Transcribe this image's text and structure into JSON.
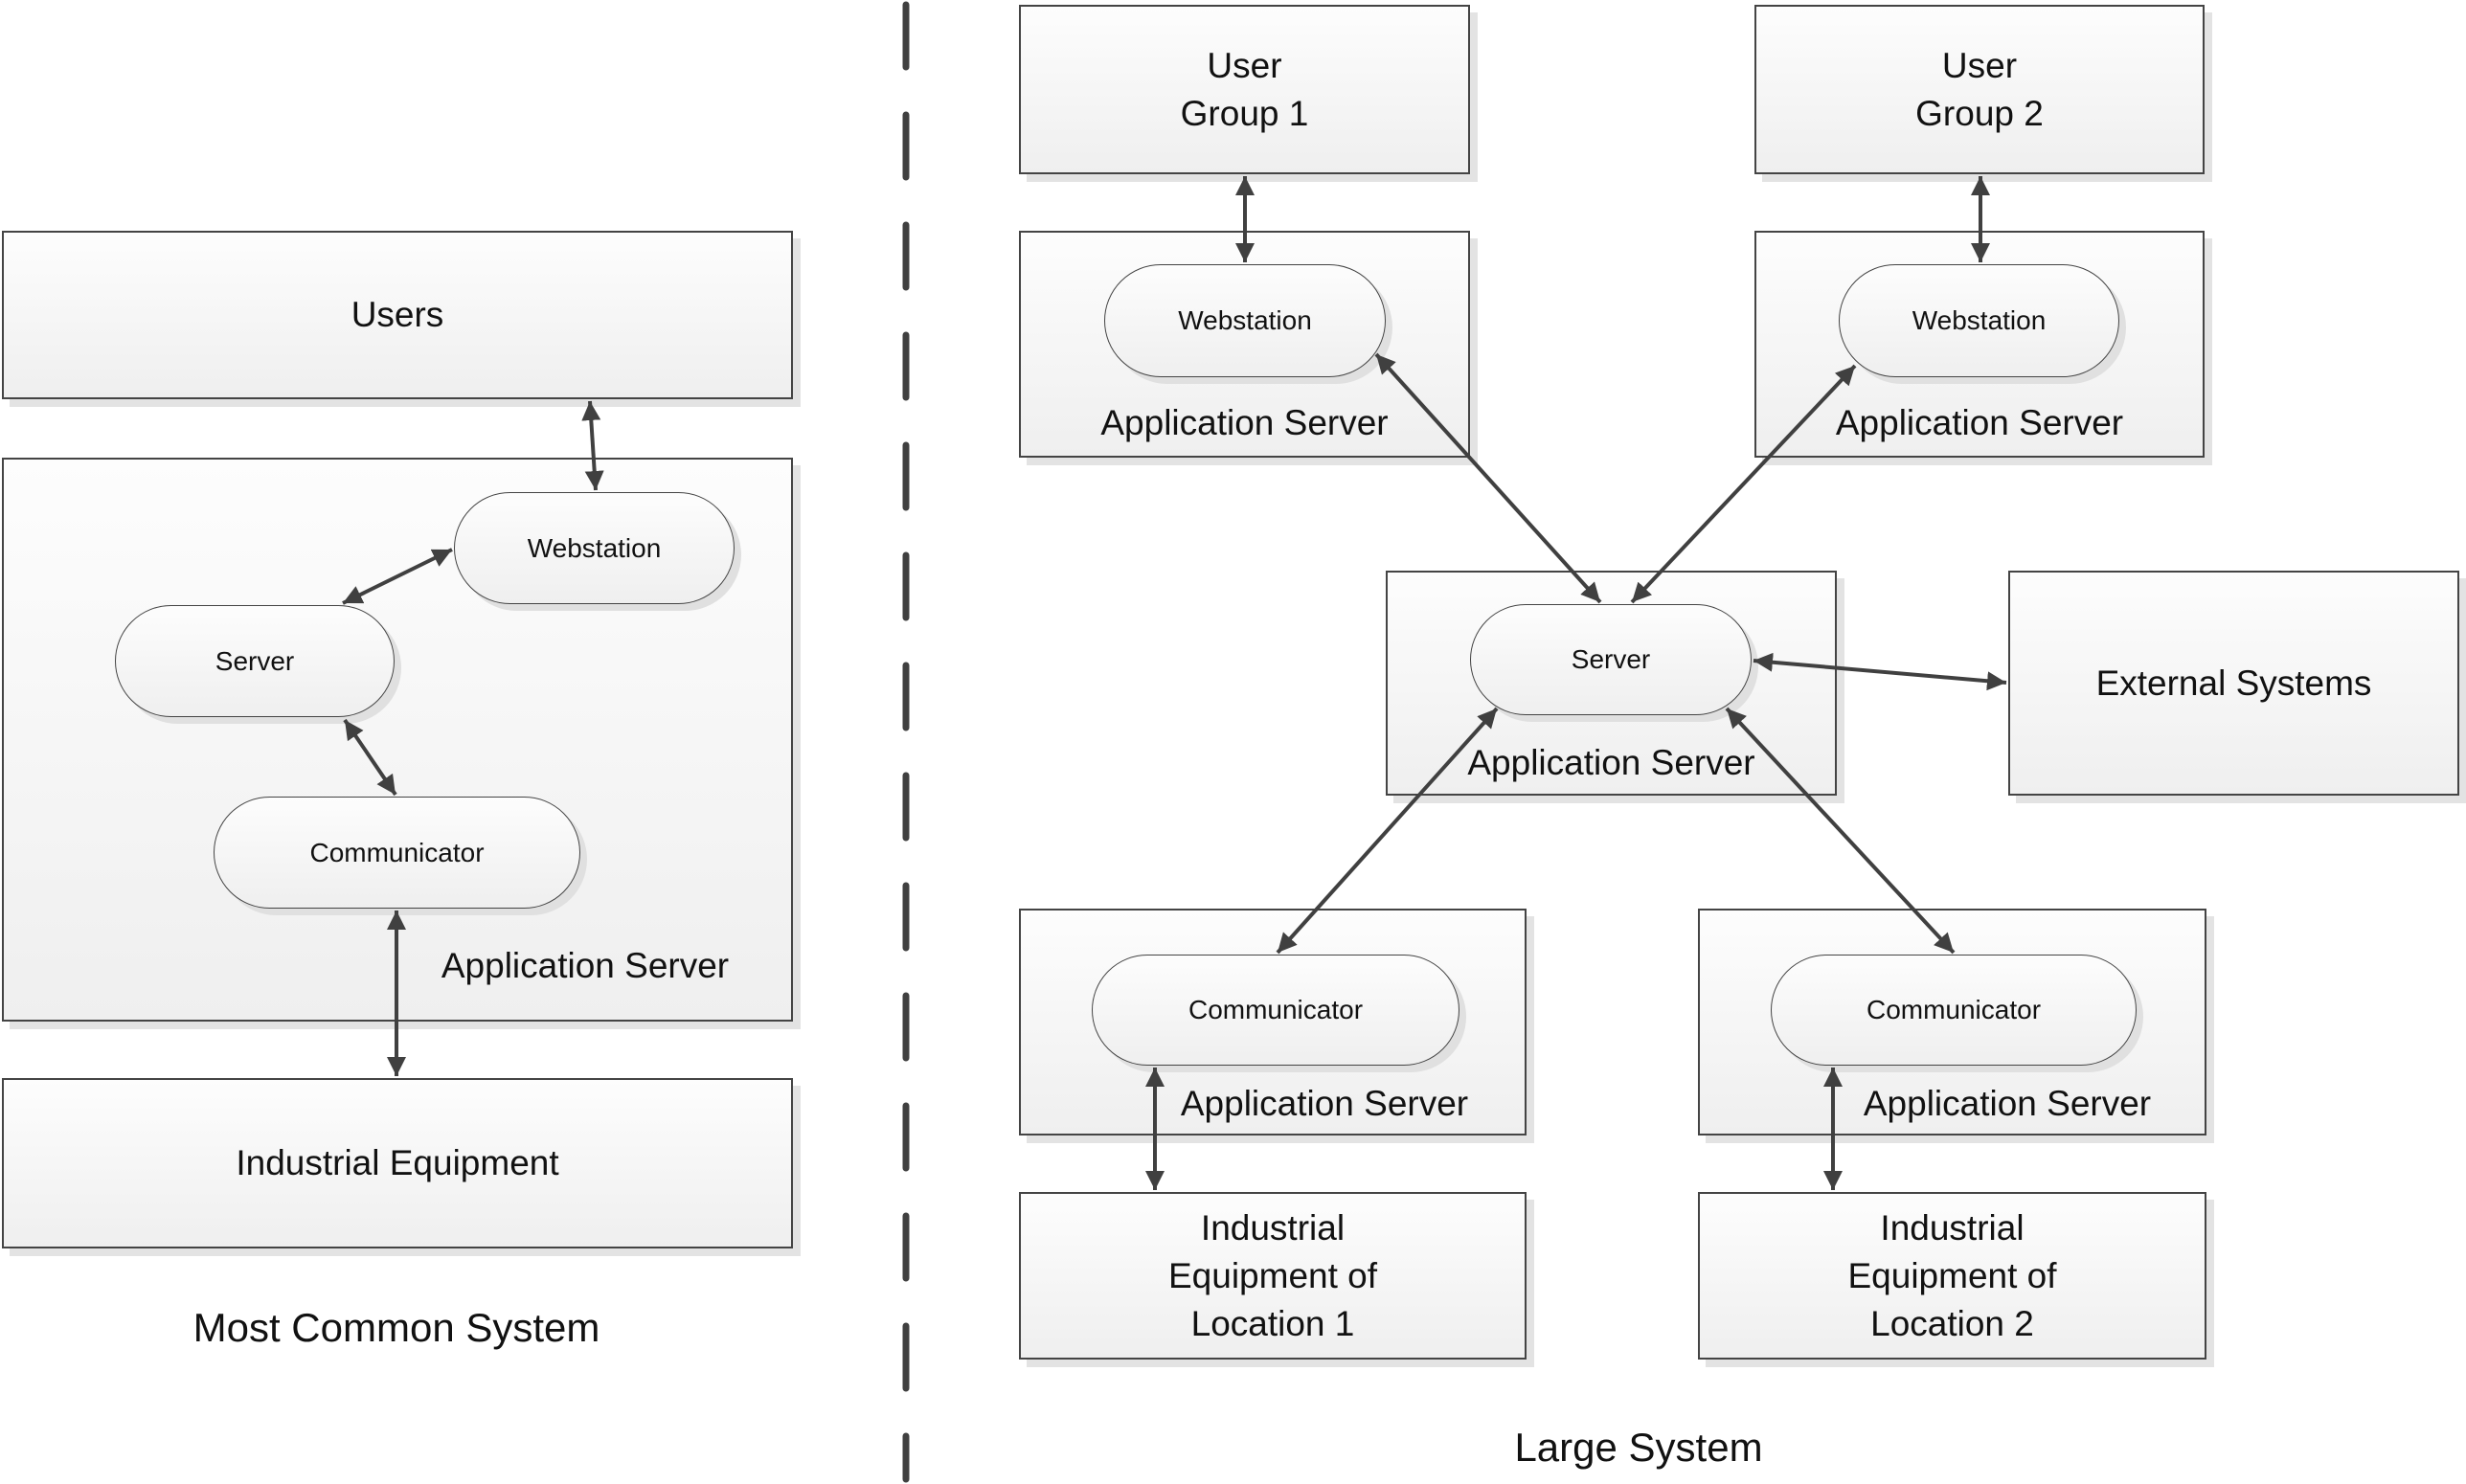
{
  "left": {
    "caption": "Most Common System",
    "users": "Users",
    "app_server": {
      "label": "Application Server",
      "webstation": "Webstation",
      "server": "Server",
      "communicator": "Communicator"
    },
    "equipment": "Industrial Equipment"
  },
  "right": {
    "caption": "Large System",
    "user_group_1": {
      "line1": "User",
      "line2": "Group 1"
    },
    "user_group_2": {
      "line1": "User",
      "line2": "Group 2"
    },
    "web_server_1": {
      "label": "Application Server",
      "webstation": "Webstation"
    },
    "web_server_2": {
      "label": "Application Server",
      "webstation": "Webstation"
    },
    "central_server": {
      "label": "Application Server",
      "server": "Server"
    },
    "external": "External Systems",
    "comm_server_1": {
      "label": "Application Server",
      "communicator": "Communicator"
    },
    "comm_server_2": {
      "label": "Application Server",
      "communicator": "Communicator"
    },
    "equipment_1": {
      "line1": "Industrial Equipment of",
      "line2": "Location 1"
    },
    "equipment_2": {
      "line1": "Industrial Equipment of",
      "line2": "Location 2"
    }
  },
  "colors": {
    "stroke": "#404040",
    "box_top": "#fdfdfd",
    "box_bottom": "#efefef",
    "shadow": "#e3e3e3"
  }
}
